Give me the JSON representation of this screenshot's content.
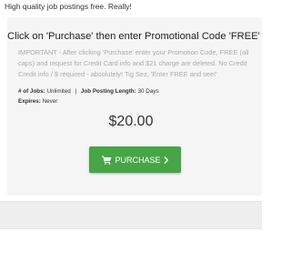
{
  "tagline": "High quality job postings free. Really!",
  "card": {
    "title": "Click on 'Purchase' then enter Promotional Code 'FREE'",
    "notice": "IMPORTANT - After clicking 'Purchase' enter your Promotion Code, FREE (all caps) and request for Credit Card info and $21 charge are deleted. No Credit Credit info / $ required - absolutely! Tig Sez, 'Enter FREE and see!'",
    "jobs_label": "# of Jobs:",
    "jobs_value": "Unlimited",
    "separator": "|",
    "length_label": "Job Posting Length:",
    "length_value": "30 Days",
    "expires_label": "Expires:",
    "expires_value": "Never",
    "price": "$20.00",
    "purchase_label": "PURCHASE"
  },
  "colors": {
    "button": "#46a546",
    "card_background": "#f5f5f5",
    "notice_text": "#aaaaaa"
  },
  "icons": {
    "cart": "shopping-cart-icon",
    "chevron": "chevron-right-icon"
  }
}
